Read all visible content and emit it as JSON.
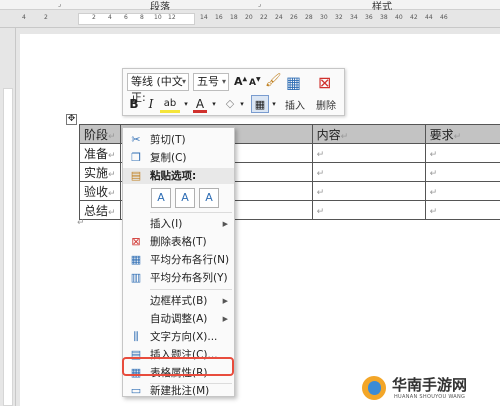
{
  "ribbon": {
    "groups": [
      "段落",
      "样式"
    ]
  },
  "ruler": {
    "ticks": [
      "4",
      "2",
      "2",
      "4",
      "6",
      "8",
      "10",
      "12",
      "14",
      "16",
      "18",
      "20",
      "22",
      "24",
      "26",
      "28",
      "30",
      "32",
      "34",
      "36",
      "38",
      "40",
      "42",
      "44",
      "46"
    ]
  },
  "table": {
    "headers": [
      "阶段",
      "",
      "内容",
      "要求"
    ],
    "rows": [
      [
        "准备",
        "",
        "",
        ""
      ],
      [
        "实施",
        "",
        "",
        ""
      ],
      [
        "验收",
        "",
        "",
        ""
      ],
      [
        "总结",
        "",
        "",
        ""
      ]
    ],
    "paragraph_mark": "↵",
    "move_handle": "✥"
  },
  "mini_toolbar": {
    "font_name": "等线 (中文正:",
    "font_size": "五号",
    "bold": "B",
    "italic": "I",
    "highlight": "ab",
    "font_color": "A",
    "insert_label": "插入",
    "delete_label": "删除"
  },
  "context_menu": {
    "items": [
      {
        "label": "剪切(T)",
        "icon": "scissors-icon",
        "glyph": "✂"
      },
      {
        "label": "复制(C)",
        "icon": "copy-icon",
        "glyph": "❐"
      },
      {
        "label": "粘贴选项:",
        "icon": "paste-icon",
        "glyph": "📋"
      },
      {
        "label": "插入(I)",
        "icon": "",
        "glyph": "",
        "submenu": true
      },
      {
        "label": "删除表格(T)",
        "icon": "delete-table-icon",
        "glyph": "⊠"
      },
      {
        "label": "平均分布各行(N)",
        "icon": "distribute-rows-icon",
        "glyph": "▦"
      },
      {
        "label": "平均分布各列(Y)",
        "icon": "distribute-columns-icon",
        "glyph": "▥"
      },
      {
        "label": "边框样式(B)",
        "icon": "",
        "glyph": "",
        "submenu": true
      },
      {
        "label": "自动调整(A)",
        "icon": "",
        "glyph": "",
        "submenu": true
      },
      {
        "label": "文字方向(X)...",
        "icon": "text-direction-icon",
        "glyph": "⫼"
      },
      {
        "label": "插入题注(C)...",
        "icon": "insert-caption-icon",
        "glyph": "▤"
      },
      {
        "label": "表格属性(R)...",
        "icon": "table-properties-icon",
        "glyph": "▦"
      },
      {
        "label": "新建批注(M)",
        "icon": "new-comment-icon",
        "glyph": "▭"
      }
    ],
    "paste_options": [
      "A",
      "A",
      "A"
    ],
    "highlighted_item": "表格属性(R)...",
    "highlight_color": "#e84c3d"
  },
  "watermark": {
    "title": "华南手游网",
    "subtitle": "HUANAN SHOUYOU WANG"
  },
  "colors": {
    "header_row": "#c3c3c3",
    "accent": "#2e6db4"
  }
}
